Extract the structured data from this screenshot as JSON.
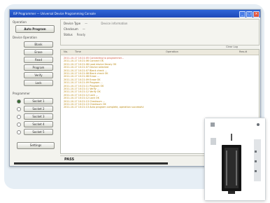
{
  "window": {
    "title": "ISP Programmer — Universal Device Programming Console",
    "controls": [
      "_",
      "□",
      "×"
    ]
  },
  "sidebar": {
    "top_section_title": "Operation",
    "auto_program_label": "Auto Program",
    "device_section_title": "Device Operation",
    "device_buttons": [
      "Blank",
      "Erase",
      "Read",
      "Program",
      "Verify",
      "Lock"
    ],
    "select_section_title": "Programmer",
    "select_buttons": [
      "Socket 1",
      "Socket 2",
      "Socket 3",
      "Socket 4",
      "Socket 5"
    ],
    "bottom_button": "Settings"
  },
  "info": {
    "rows": [
      {
        "label": "Device Type",
        "value": "—"
      },
      {
        "label": "Checksum",
        "value": "—"
      },
      {
        "label": "Status",
        "value": "Ready"
      }
    ],
    "extra": "Device information"
  },
  "log": {
    "columns": [
      "No.",
      "Time",
      "Operation",
      "Result"
    ],
    "header_right": "Clear Log",
    "lines": [
      "2011-10-17 10:21:05 Connecting to programmer...",
      "2011-10-17 10:21:06 Connect OK",
      "2011-10-17 10:21:06 Load device library OK",
      "2011-10-17 10:21:07 Device selected",
      "2011-10-17 10:21:07 Blank check ...",
      "2011-10-17 10:21:08 Blank check OK",
      "2011-10-17 10:21:08 Erase ...",
      "2011-10-17 10:21:09 Erase OK",
      "2011-10-17 10:21:09 Program ...",
      "2011-10-17 10:21:11 Program OK",
      "2011-10-17 10:21:11 Verify ...",
      "2011-10-17 10:21:12 Verify OK",
      "2011-10-17 10:21:12 Lock ...",
      "2011-10-17 10:21:12 Lock OK",
      "2011-10-17 10:21:13 Checksum ...",
      "2011-10-17 10:21:13 Checksum OK",
      "2011-10-17 10:21:13 Auto program complete, operation successful"
    ]
  },
  "status": {
    "text": "PASS"
  },
  "progress": {
    "fraction": 1.0
  },
  "colors": {
    "log_text": "#b8860b",
    "log_text_first": "#d0563a",
    "status_text": "#1f1f1f"
  }
}
